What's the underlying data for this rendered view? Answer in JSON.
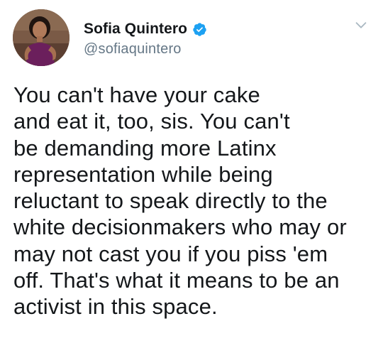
{
  "author": {
    "display_name": "Sofia Quintero",
    "handle": "@sofiaquintero",
    "verified": true,
    "avatar_icon": "profile-photo",
    "verified_icon": "verified-badge-icon",
    "verified_color": "#1da1f2"
  },
  "menu": {
    "icon": "chevron-down-icon"
  },
  "tweet": {
    "text": "You can't have your cake\nand eat it, too, sis. You can't\nbe demanding more Latinx\nrepresentation while being\nreluctant to speak directly to the\nwhite decisionmakers who may or\nmay not cast you if you piss 'em\noff. That's what it means to be an\nactivist in this space."
  },
  "colors": {
    "text_primary": "#14171a",
    "text_secondary": "#657786",
    "accent": "#1da1f2",
    "chevron": "#aab8c2"
  }
}
